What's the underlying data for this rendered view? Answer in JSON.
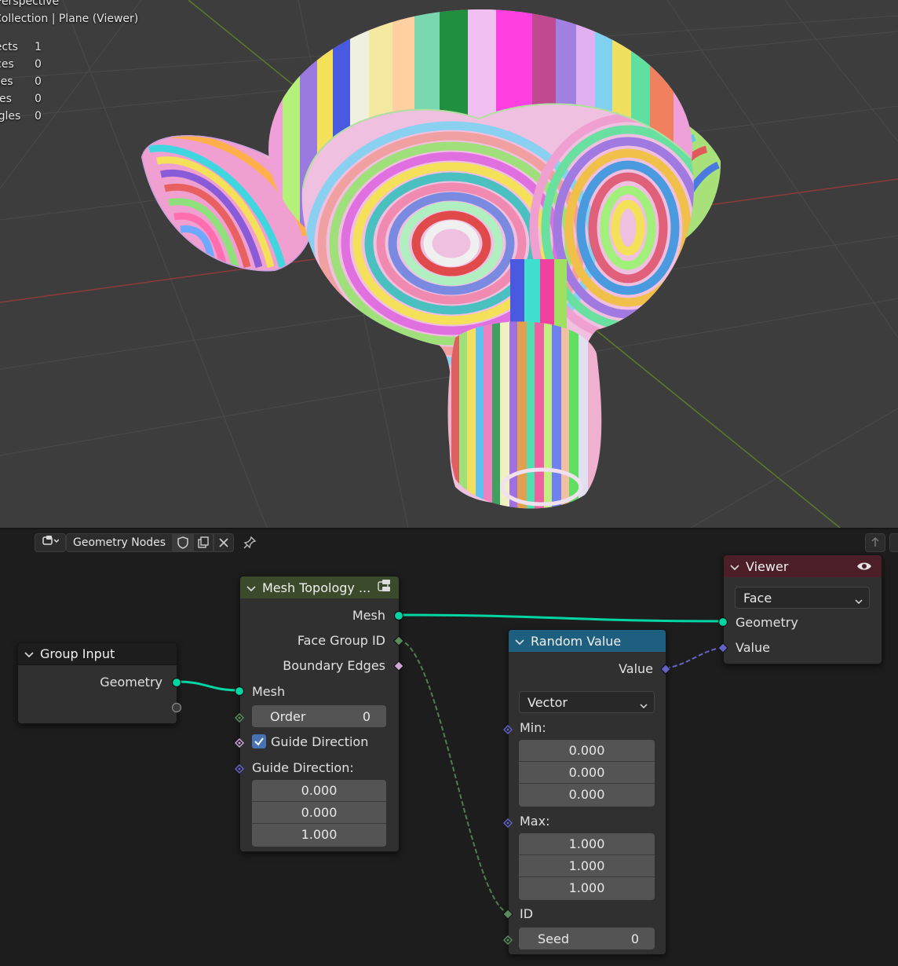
{
  "viewport": {
    "title": "Perspective",
    "collection": "Collection | Plane (Viewer)",
    "stats": [
      {
        "label": "Objects",
        "value": "1"
      },
      {
        "label": "Vertices",
        "value": "0"
      },
      {
        "label": "Edges",
        "value": "0"
      },
      {
        "label": "Faces",
        "value": "0"
      },
      {
        "label": "Triangles",
        "value": "0"
      }
    ]
  },
  "editor": {
    "tree_name": "Geometry Nodes",
    "icons": [
      "editor-type-icon",
      "shield-icon",
      "duplicate-icon",
      "close-icon",
      "pin-icon",
      "parent-node-icon"
    ]
  },
  "nodes": {
    "group_input": {
      "title": "Group Input",
      "output": "Geometry"
    },
    "mesh_topology": {
      "title": "Mesh Topology ...",
      "outputs": [
        "Mesh",
        "Face Group ID",
        "Boundary Edges"
      ],
      "input_mesh": "Mesh",
      "order_label": "Order",
      "order_value": "0",
      "guide_checkbox_label": "Guide Direction",
      "guide_checked": true,
      "guide_vector_label": "Guide Direction:",
      "guide_vector": [
        "0.000",
        "0.000",
        "1.000"
      ]
    },
    "random_value": {
      "title": "Random Value",
      "output": "Value",
      "data_type": "Vector",
      "min_label": "Min:",
      "min": [
        "0.000",
        "0.000",
        "0.000"
      ],
      "max_label": "Max:",
      "max": [
        "1.000",
        "1.000",
        "1.000"
      ],
      "id_label": "ID",
      "seed_label": "Seed",
      "seed_value": "0"
    },
    "viewer": {
      "title": "Viewer",
      "domain": "Face",
      "inputs": [
        "Geometry",
        "Value"
      ]
    }
  },
  "colors": {
    "geometry_socket": "#00d6a3",
    "int_socket": "#598c5c",
    "bool_socket": "#cca6d6",
    "vector_socket": "#6363c7",
    "input_header": "#1d1d1d",
    "geometry_header": "#3a4a2a",
    "utility_header": "#1e5f80",
    "output_header": "#4b1e28"
  }
}
